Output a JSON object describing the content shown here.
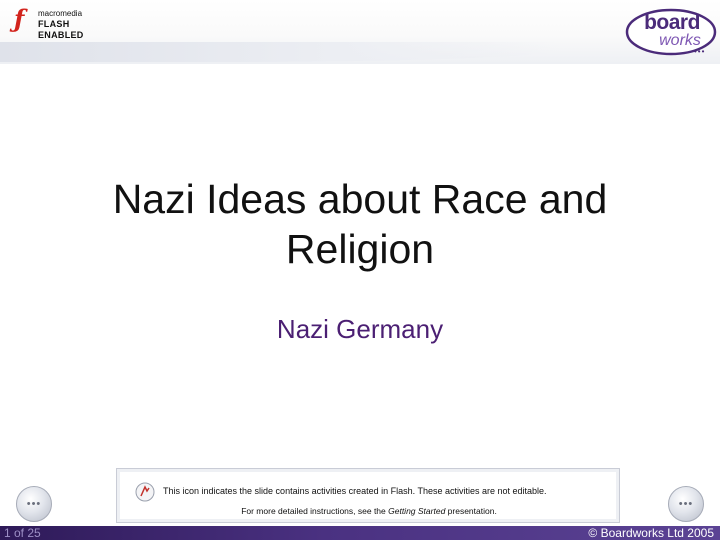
{
  "flash_badge": {
    "icon": "flash-f-icon",
    "line1": "macromedia",
    "line2": "FLASH ENABLED",
    "f_color": "#d2231c"
  },
  "logo": {
    "top": "board",
    "bottom": "works",
    "dots": "•••",
    "color": "#4b2b7a"
  },
  "slide": {
    "title_line1": "Nazi Ideas about Race and",
    "title_line2": "Religion",
    "subtitle": "Nazi Germany"
  },
  "notice": {
    "icon": "flash-activity-icon",
    "line1": "This icon indicates the slide contains activities created in Flash. These activities are not editable.",
    "line2_prefix": "For more detailed instructions, see the ",
    "line2_link": "Getting Started",
    "line2_suffix": " presentation."
  },
  "nav": {
    "prev_icon": "prev-dots-icon",
    "next_icon": "next-dots-icon",
    "dots": "•••"
  },
  "footer": {
    "slide_counter": "1 of 25",
    "copyright": "© Boardworks Ltd 2005",
    "bar_color": "#2e1a58"
  }
}
